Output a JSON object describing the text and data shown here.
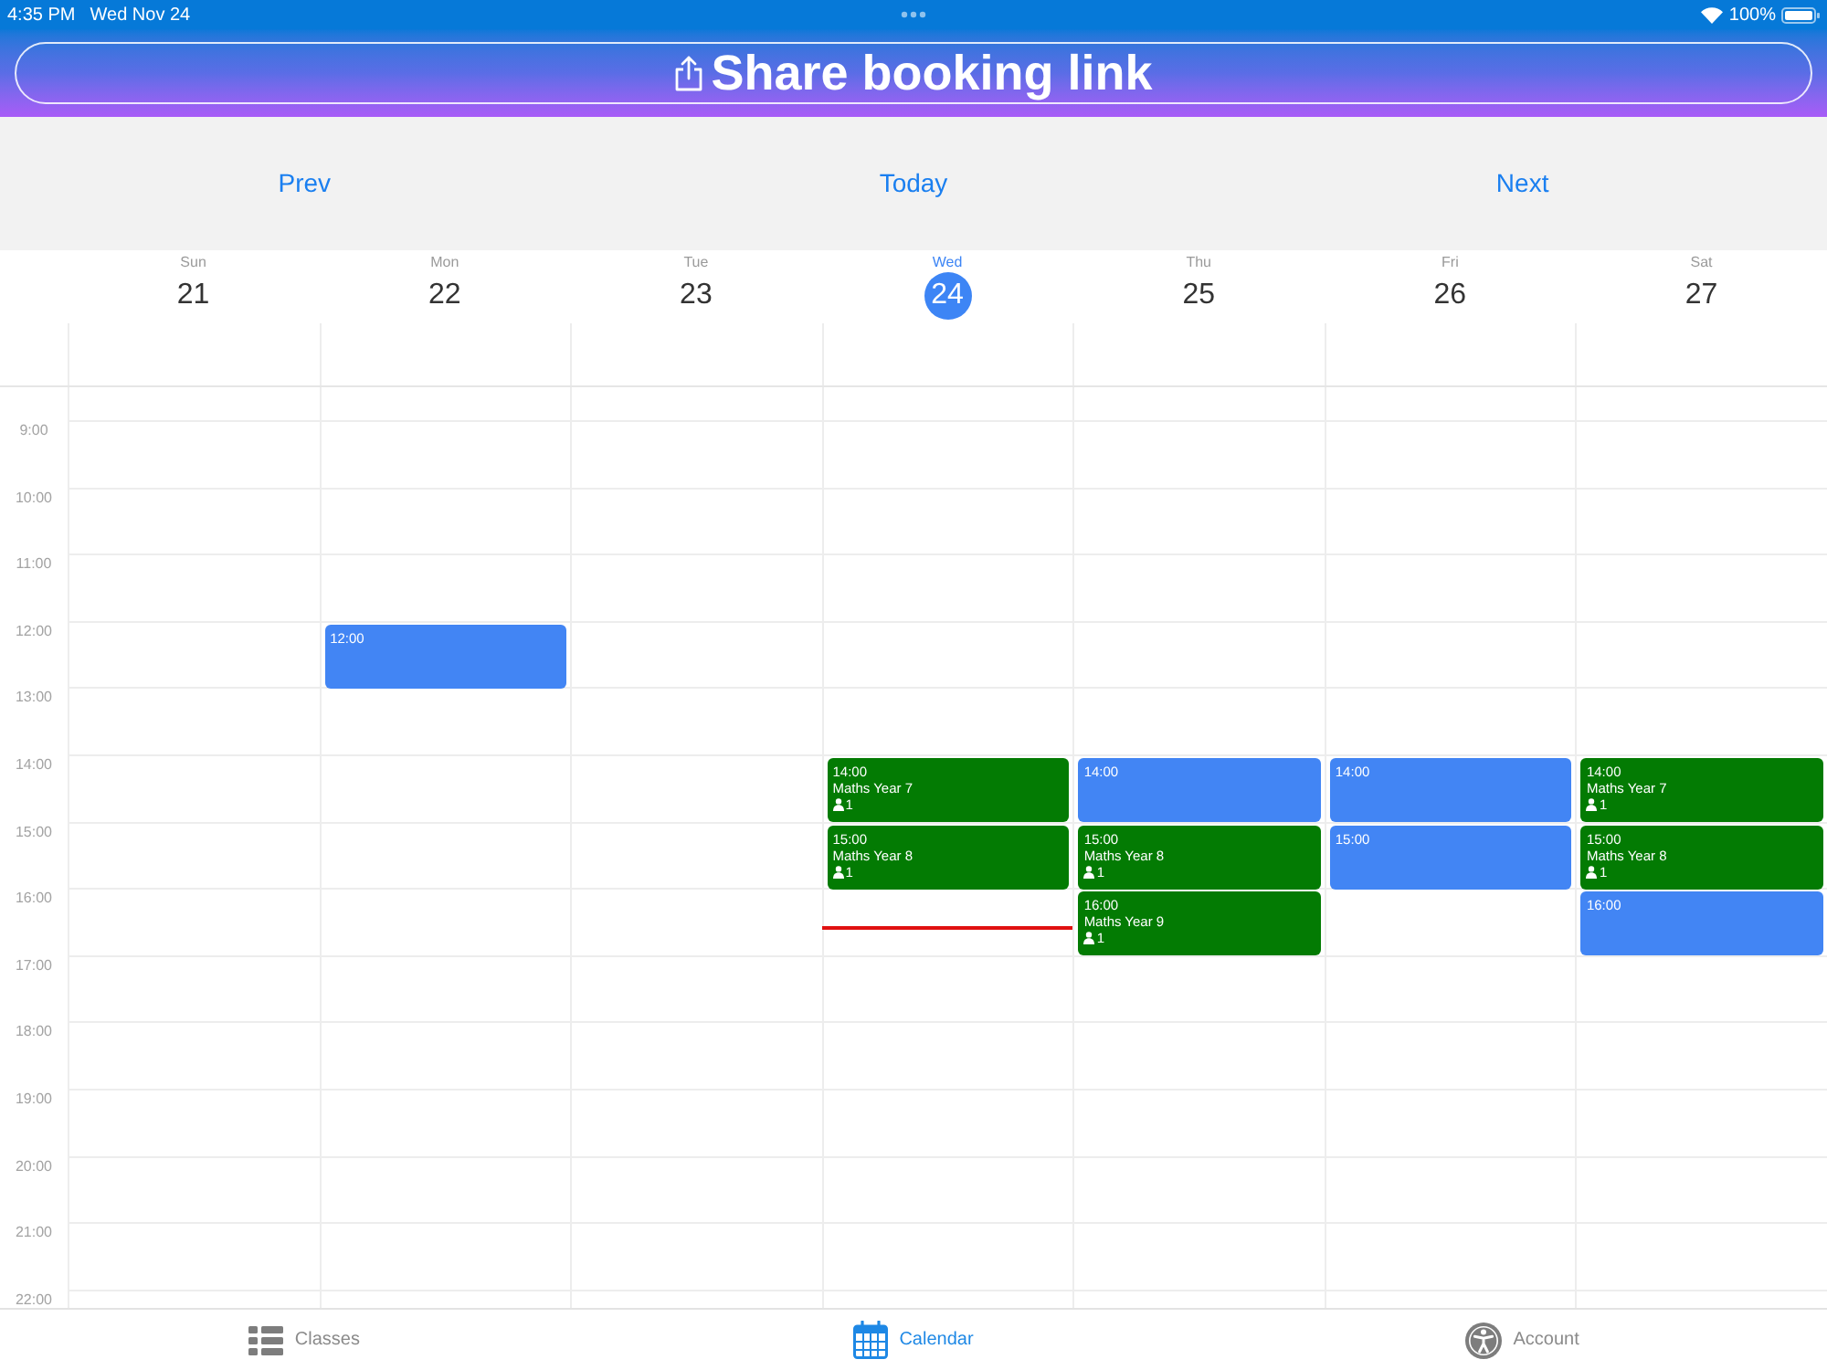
{
  "status_bar": {
    "time": "4:35 PM",
    "date": "Wed Nov 24",
    "battery": "100%"
  },
  "share_button": {
    "label": "Share booking link"
  },
  "nav": {
    "prev": "Prev",
    "today": "Today",
    "next": "Next"
  },
  "days": [
    {
      "weekday": "Sun",
      "date": "21",
      "selected": false
    },
    {
      "weekday": "Mon",
      "date": "22",
      "selected": false,
      "events": [
        {
          "time": "12:00",
          "color": "#4285f4"
        }
      ]
    },
    {
      "weekday": "Tue",
      "date": "23",
      "selected": false
    },
    {
      "weekday": "Wed",
      "date": "24",
      "selected": true,
      "events": [
        {
          "time": "14:00",
          "title": "Maths Year 7",
          "attendees": "1",
          "color": "#037b03"
        },
        {
          "time": "15:00",
          "title": "Maths Year 8",
          "attendees": "1",
          "color": "#037b03"
        }
      ]
    },
    {
      "weekday": "Thu",
      "date": "25",
      "selected": false,
      "events": [
        {
          "time": "14:00",
          "color": "#4285f4"
        },
        {
          "time": "15:00",
          "title": "Maths Year 8",
          "attendees": "1",
          "color": "#037b03"
        },
        {
          "time": "16:00",
          "title": "Maths Year 9",
          "attendees": "1",
          "color": "#037b03"
        }
      ]
    },
    {
      "weekday": "Fri",
      "date": "26",
      "selected": false,
      "events": [
        {
          "time": "14:00",
          "color": "#4285f4"
        },
        {
          "time": "15:00",
          "color": "#4285f4"
        }
      ]
    },
    {
      "weekday": "Sat",
      "date": "27",
      "selected": false,
      "events": [
        {
          "time": "14:00",
          "title": "Maths Year 7",
          "attendees": "1",
          "color": "#037b03"
        },
        {
          "time": "15:00",
          "title": "Maths Year 8",
          "attendees": "1",
          "color": "#037b03"
        },
        {
          "time": "16:00",
          "color": "#4285f4"
        }
      ]
    }
  ],
  "time_labels": [
    "9:00",
    "10:00",
    "11:00",
    "12:00",
    "13:00",
    "14:00",
    "15:00",
    "16:00",
    "17:00",
    "18:00",
    "19:00",
    "20:00",
    "21:00",
    "22:00"
  ],
  "tabs": [
    {
      "label": "Classes",
      "selected": false
    },
    {
      "label": "Calendar",
      "selected": true
    },
    {
      "label": "Account",
      "selected": false
    }
  ]
}
